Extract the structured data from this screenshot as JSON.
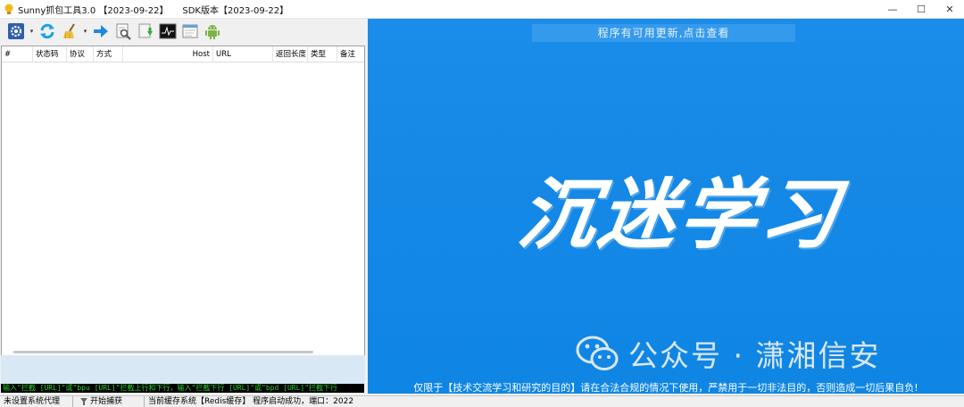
{
  "window": {
    "title": "Sunny抓包工具3.0 【2023-09-22】     SDK版本【2023-09-22】",
    "minimize": "—",
    "maximize": "☐",
    "close": "✕"
  },
  "toolbar": {
    "icons": [
      "gear-icon",
      "refresh-icon",
      "broom-icon",
      "arrow-right-icon",
      "search-edit-icon",
      "download-icon",
      "terminal-icon",
      "notepad-icon",
      "android-icon"
    ],
    "dropdown_glyph": "▾"
  },
  "grid": {
    "columns": [
      {
        "label": "#"
      },
      {
        "label": "状态码"
      },
      {
        "label": "协议"
      },
      {
        "label": "方式"
      },
      {
        "label": "Host"
      },
      {
        "label": "URL"
      },
      {
        "label": "返回长度"
      },
      {
        "label": "类型"
      },
      {
        "label": "备注"
      }
    ],
    "rows": []
  },
  "command_bar": {
    "text": "输入\"拦截 [URL]\"或\"bpu [URL]\"拦截上行和下行，输入\"拦截下行 [URL]\"或\"bpd [URL]\"拦截下行"
  },
  "right_panel": {
    "update_banner": "程序有可用更新,点击查看",
    "hero_title": "沉迷学习",
    "watermark": "公众号 · 潇湘信安",
    "disclaimer": "仅限于【技术交流学习和研究的目的】请在合法合规的情况下使用，严禁用于一切非法目的，否则造成一切后果自负!",
    "accent_color": "#1588e6"
  },
  "statusbar": {
    "proxy": "未设置系统代理",
    "capture": "开始捕获",
    "cache": "当前缓存系统【Redis缓存】 程序启动成功，端口：2022"
  }
}
